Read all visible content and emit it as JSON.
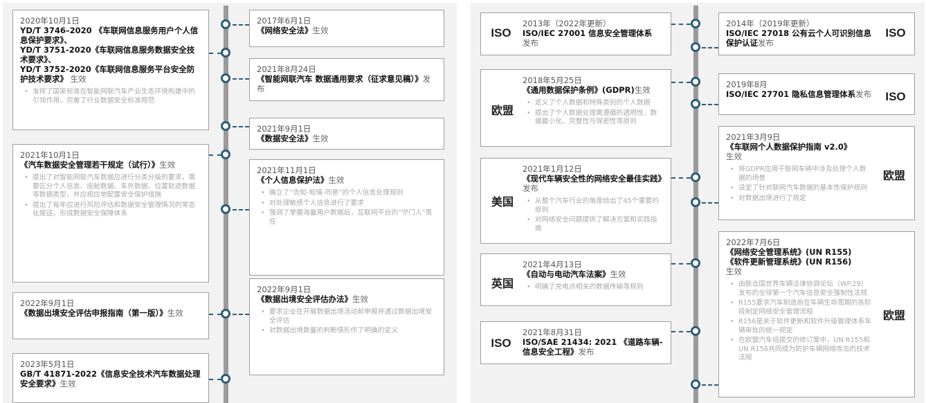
{
  "left": {
    "items": [
      {
        "date": "2020年10月1日",
        "title": "YD/T 3746–2020 《车联网信息服务用户个人信息保护要求》、\nYD/T 3751-2020《车联网信息服务数据安全技术要求》、\nYD/T 3752-2020《车联网信息服务平台安全防护技术要求》",
        "action": " 生效",
        "bullets": [
          "发挥了国家标准在智能网联汽车产业生态环境构建中的引领作用，完善了行业数据安全标准规范"
        ]
      },
      {
        "date": "2017年6月1日",
        "title": "《网络安全法》",
        "action": "生效",
        "bullets": []
      },
      {
        "date": "2021年8月24日",
        "title": "《智能网联汽车 数据通用要求（征求意见稿）》",
        "action": "发布",
        "bullets": []
      },
      {
        "date": "2021年9月1日",
        "title": "《数据安全法》",
        "action": "生效",
        "bullets": []
      },
      {
        "date": "2021年10月1日",
        "title": "《汽车数据安全管理若干规定（试行）》",
        "action": "生效",
        "bullets": [
          "提出了对智能网联汽车数据应进行分类分级的要求，需要区分个人信息、座舱数据、车外数据、位置轨迹数据等数据类型，并应相应地配置安全保护措施",
          "提出了每年应进行风险评估和数据安全管理情况的常态化报送，形成数据安全保障体系"
        ]
      },
      {
        "date": "2021年11月1日",
        "title": "《个人信息保护法》",
        "action": "生效",
        "bullets": [
          "确立了“告知-知情-同意”的个人信息处理规则",
          "对处理敏感个人信息进行了要求",
          "强调了掌握海量用户数据后，互联网平台的“守门人”责任"
        ]
      },
      {
        "date": "2022年9月1日",
        "title": "《数据出境安全评估申报指南（第一版）》",
        "action": "生效",
        "bullets": []
      },
      {
        "date": "2022年9月1日",
        "title": "《数据出境安全评估办法》",
        "action": "生效",
        "bullets": [
          "要求企业在开展数据出境活动前申报并通过数据出境安全评估",
          "对数据出境数量的判断情形作了明确的定义"
        ]
      },
      {
        "date": "2023年5月1日",
        "title": "GB/T 41871-2022《信息安全技术汽车数据处理安全要求》",
        "action": "生效",
        "bullets": []
      }
    ]
  },
  "right": {
    "items": [
      {
        "tag": "ISO",
        "date": "2013年（2022年更新）",
        "title": "ISO/IEC 27001 信息安全管理体系",
        "action": "发布",
        "bullets": []
      },
      {
        "tag": "ISO",
        "date": "2014年（2019年更新）",
        "title": "ISO/IEC 27018 公有云个人可识别信息保护认证",
        "action": "发布",
        "bullets": []
      },
      {
        "tag": "欧盟",
        "date": "2018年5月25日",
        "title": "《通用数据保护条例》(GDPR)",
        "action": "生效",
        "bullets": [
          "定义了个人数据和特殊类别的个人数据",
          "提出了个人数据处理需遵循的透明性、数据最小化、完整性与保密性等原则"
        ]
      },
      {
        "tag": "ISO",
        "date": "2019年8月",
        "title": "ISO/IEC 27701 隐私信息管理体系",
        "action": "发布",
        "bullets": []
      },
      {
        "tag": "欧盟",
        "date": "2021年3月9日",
        "title": "《车联网个人数据保护指南 v2.0》",
        "action": "生效",
        "bullets": [
          "将GDPR应用于联网车辆中涉及处理个人数据的场景",
          "设定了针对联网汽车数据的基本性保护规则",
          "对数据出境进行了规定"
        ]
      },
      {
        "tag": "美国",
        "date": "2021年1月12日",
        "title": "《现代车辆安全性的网络安全最佳实践》",
        "action": "发布",
        "bullets": [
          "从整个汽车行业的角度给出了45个重要的原则",
          "对网络安全问题提供了解决方案和实践指南"
        ]
      },
      {
        "tag": "欧盟",
        "date": "2022年7月6日",
        "title": "《网络安全管理系统》(UN R155)\n《软件更新管理系统》(UN R156)",
        "action": "生效",
        "bullets": [
          "由联合国世界车辆法律协调论坛（WP.29）发布的全球第一个汽车信息安全强制性法规",
          "R155要求汽车制造商在车辆生命周期的各阶段制定网络安全管理流程",
          "R156是关于软件更新和软件升级管理体系车辆审批的统一规定",
          "在欧盟汽车组提交的修订案中，UN R155和UN R156共同成为防护车辆网络攻击的技术法规"
        ]
      },
      {
        "tag": "英国",
        "date": "2021年4月13日",
        "title": "《自动与电动汽车法案》",
        "action": "生效",
        "bullets": [
          "明确了充电点相关的数据传输等规则"
        ]
      },
      {
        "tag": "ISO",
        "date": "2021年8月31日",
        "title": "ISO/SAE 21434: 2021 《道路车辆-信息安全工程》",
        "action": "发布",
        "bullets": []
      }
    ]
  }
}
